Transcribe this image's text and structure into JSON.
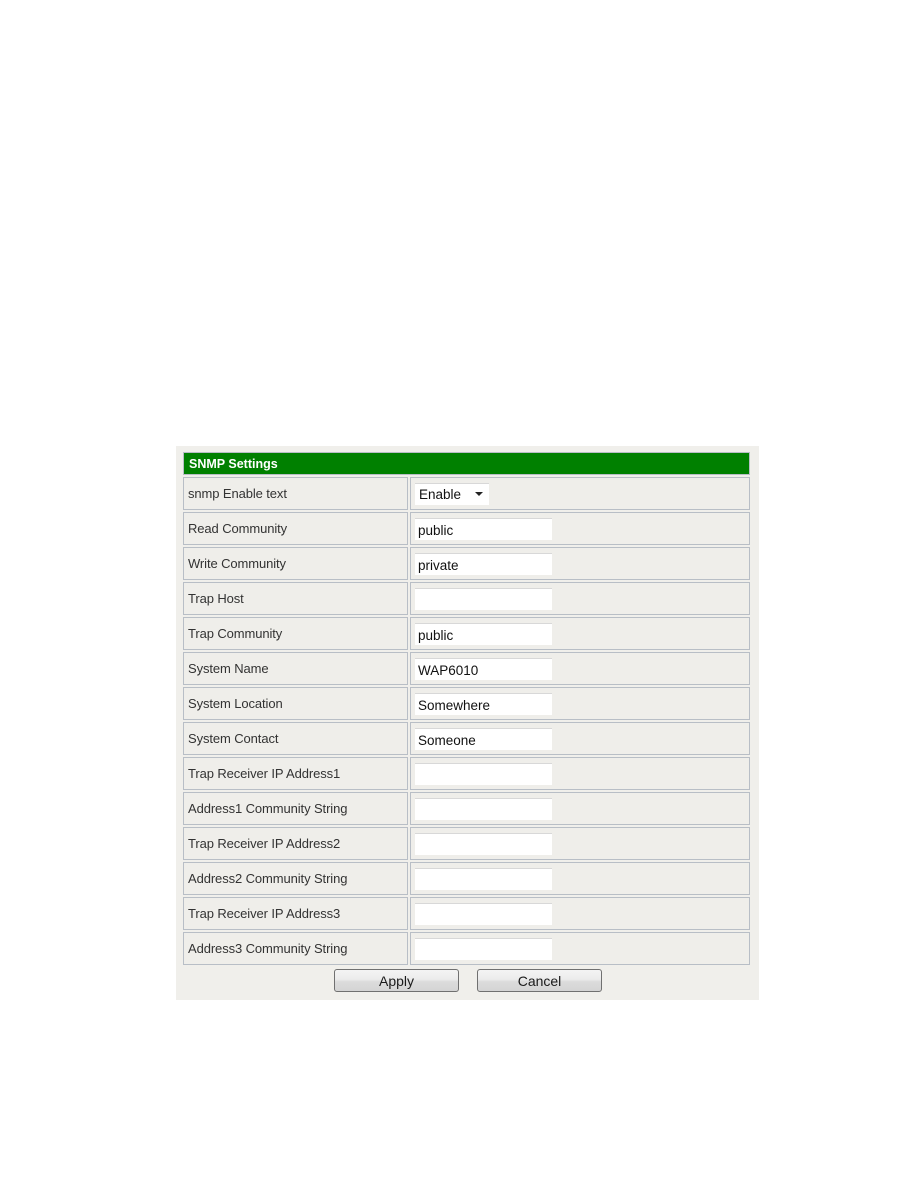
{
  "panel": {
    "title": "SNMP Settings",
    "header_color": "#008000"
  },
  "fields": [
    {
      "label": "snmp Enable text",
      "type": "select",
      "value": "Enable"
    },
    {
      "label": "Read Community",
      "type": "text",
      "value": "public"
    },
    {
      "label": "Write Community",
      "type": "text",
      "value": "private"
    },
    {
      "label": "Trap Host",
      "type": "text",
      "value": ""
    },
    {
      "label": "Trap Community",
      "type": "text",
      "value": "public"
    },
    {
      "label": "System Name",
      "type": "text",
      "value": "WAP6010"
    },
    {
      "label": "System Location",
      "type": "text",
      "value": "Somewhere"
    },
    {
      "label": "System Contact",
      "type": "text",
      "value": "Someone"
    },
    {
      "label": "Trap Receiver IP Address1",
      "type": "text",
      "value": ""
    },
    {
      "label": "Address1 Community String",
      "type": "text",
      "value": ""
    },
    {
      "label": "Trap Receiver IP Address2",
      "type": "text",
      "value": ""
    },
    {
      "label": "Address2 Community String",
      "type": "text",
      "value": ""
    },
    {
      "label": "Trap Receiver IP Address3",
      "type": "text",
      "value": ""
    },
    {
      "label": "Address3 Community String",
      "type": "text",
      "value": ""
    }
  ],
  "buttons": {
    "apply": "Apply",
    "cancel": "Cancel"
  }
}
